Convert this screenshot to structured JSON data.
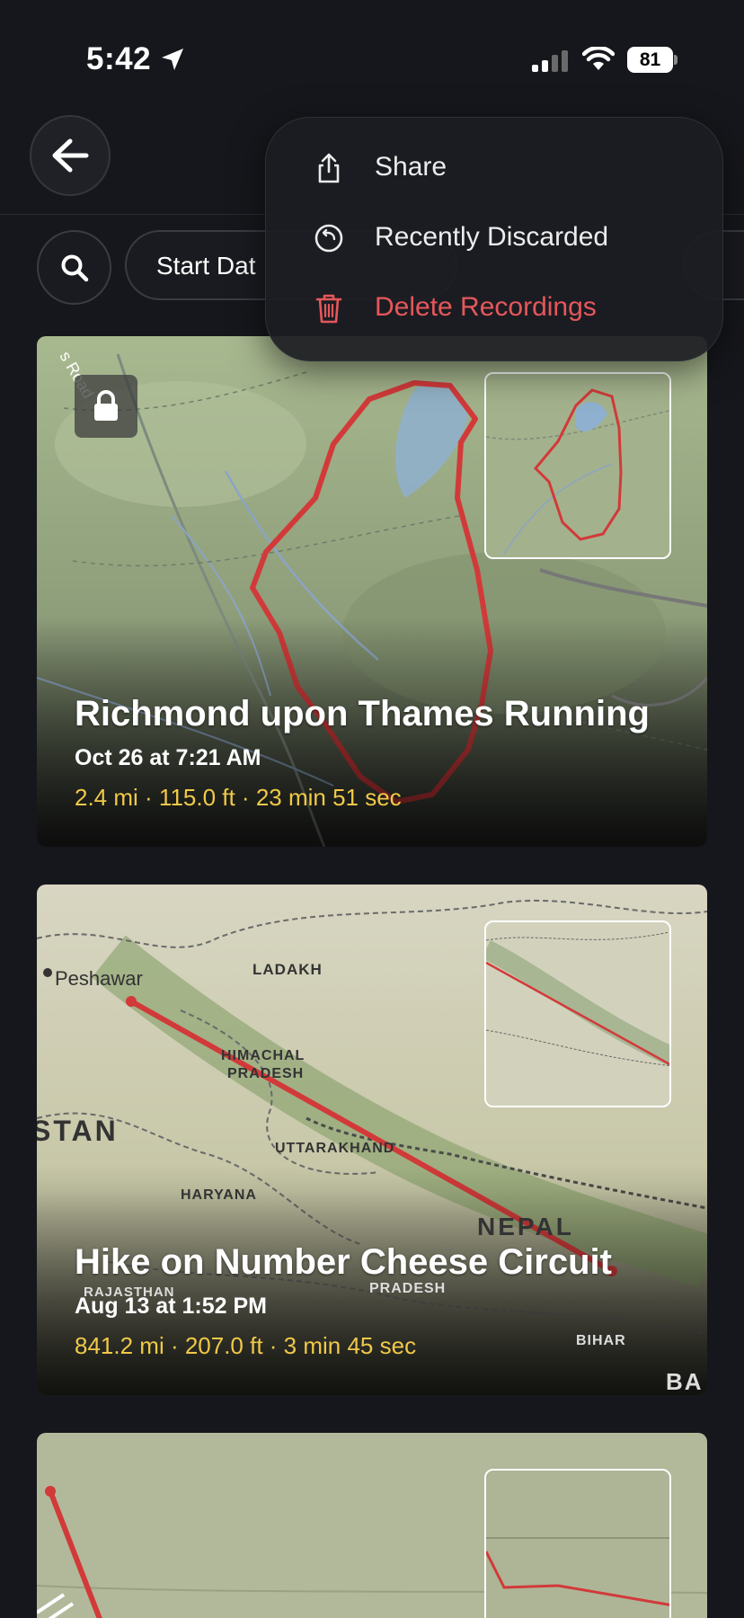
{
  "status_bar": {
    "time": "5:42",
    "battery": "81"
  },
  "filters": {
    "chip_label": "Start Dat"
  },
  "menu": {
    "items": [
      {
        "label": "Share",
        "icon": "share-icon"
      },
      {
        "label": "Recently Discarded",
        "icon": "recently-discarded-icon"
      },
      {
        "label": "Delete Recordings",
        "icon": "trash-icon",
        "color": "#e5575b"
      }
    ]
  },
  "recordings": [
    {
      "title": "Richmond upon Thames Running",
      "date": "Oct 26 at 7:21 AM",
      "stats": "2.4 mi · 115.0 ft · 23 min 51 sec",
      "locked": true,
      "map_labels": [
        "s Road"
      ]
    },
    {
      "title": "Hike on Number Cheese Circuit",
      "date": "Aug 13 at 1:52 PM",
      "stats": "841.2 mi · 207.0 ft · 3 min 45 sec",
      "locked": false,
      "map_labels": [
        "Peshawar",
        "LADAKH",
        "HIMACHAL",
        "PRADESH",
        "STAN",
        "UTTARAKHAND",
        "HARYANA",
        "NEPAL",
        "RAJASTHAN",
        "PRADESH",
        "BIHAR",
        "BA"
      ]
    }
  ],
  "colors": {
    "route": "#d23a3a",
    "stats": "#f0c948",
    "danger": "#e5575b"
  }
}
